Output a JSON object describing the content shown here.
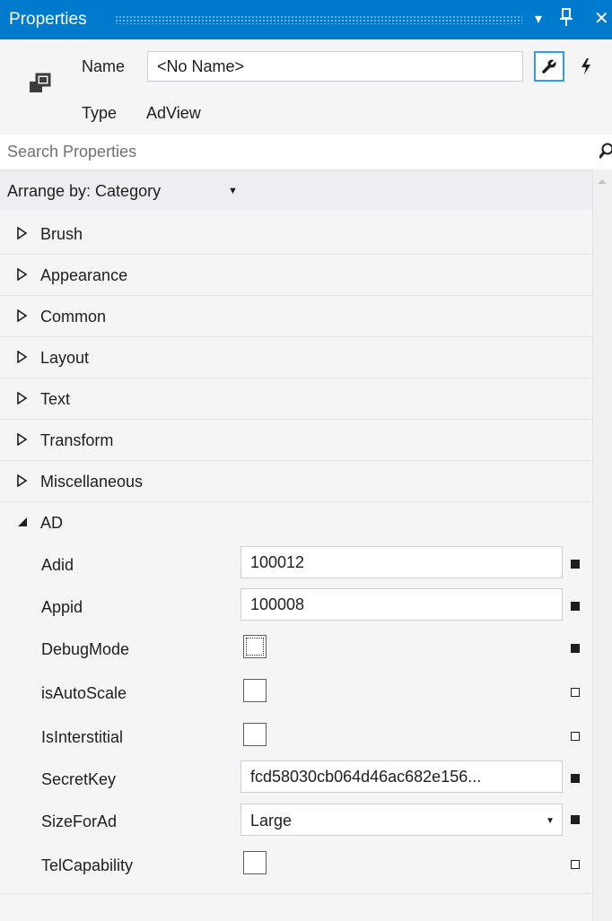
{
  "panel": {
    "title": "Properties",
    "buttons": {
      "dropdown": "▾",
      "pin": "⊥",
      "close": "✕"
    }
  },
  "element": {
    "name_label": "Name",
    "name_value": "<No Name>",
    "type_label": "Type",
    "type_value": "AdView"
  },
  "search": {
    "placeholder": "Search Properties"
  },
  "arrange": {
    "label": "Arrange by: Category",
    "caret": "▼"
  },
  "categories": [
    {
      "label": "Brush",
      "expanded": false
    },
    {
      "label": "Appearance",
      "expanded": false
    },
    {
      "label": "Common",
      "expanded": false
    },
    {
      "label": "Layout",
      "expanded": false
    },
    {
      "label": "Text",
      "expanded": false
    },
    {
      "label": "Transform",
      "expanded": false
    },
    {
      "label": "Miscellaneous",
      "expanded": false
    },
    {
      "label": "AD",
      "expanded": true
    }
  ],
  "ad_properties": [
    {
      "name": "Adid",
      "kind": "text",
      "value": "100012",
      "set": true
    },
    {
      "name": "Appid",
      "kind": "text",
      "value": "100008",
      "set": true
    },
    {
      "name": "DebugMode",
      "kind": "checkbox",
      "checked": false,
      "set": true
    },
    {
      "name": "isAutoScale",
      "kind": "checkbox",
      "checked": false,
      "set": false
    },
    {
      "name": "IsInterstitial",
      "kind": "checkbox",
      "checked": false,
      "set": false
    },
    {
      "name": "SecretKey",
      "kind": "text",
      "value": "fcd58030cb064d46ac682e156...",
      "set": true
    },
    {
      "name": "SizeForAd",
      "kind": "select",
      "value": "Large",
      "set": true
    },
    {
      "name": "TelCapability",
      "kind": "checkbox",
      "checked": false,
      "set": false
    }
  ],
  "colors": {
    "accent": "#007acc",
    "panel_bg": "#f5f5f5",
    "field_border": "#cccedb",
    "focus_border": "#3399ff"
  }
}
